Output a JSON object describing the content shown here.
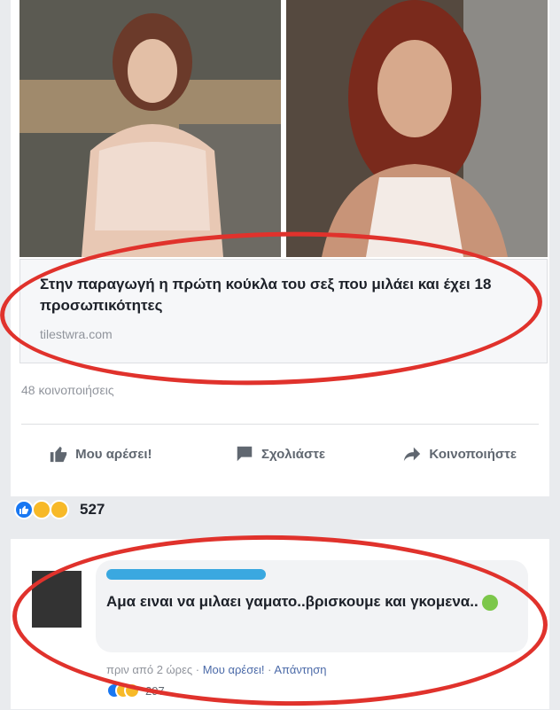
{
  "post": {
    "link_title": "Στην παραγωγή η πρώτη κούκλα του σεξ που μιλάει και έχει 18 προσωπικότητες",
    "link_domain": "tilestwra.com",
    "shares": "48 κοινοποιήσεις",
    "actions": {
      "like": "Μου αρέσει!",
      "comment": "Σχολιάστε",
      "share": "Κοινοποιήστε"
    },
    "reaction_count": "527"
  },
  "comment": {
    "text": "Αμα ειναι να μιλαει γαματο..βρισκουμε και γκομενα..",
    "meta_time": "πριν από 2 ώρες",
    "meta_like": "Μου αρέσει!",
    "meta_reply": "Απάντηση",
    "reaction_count": "297"
  },
  "colors": {
    "annotation_circle": "#e0322c",
    "like_blue": "#1877f2",
    "haha_yellow": "#f7b928"
  }
}
